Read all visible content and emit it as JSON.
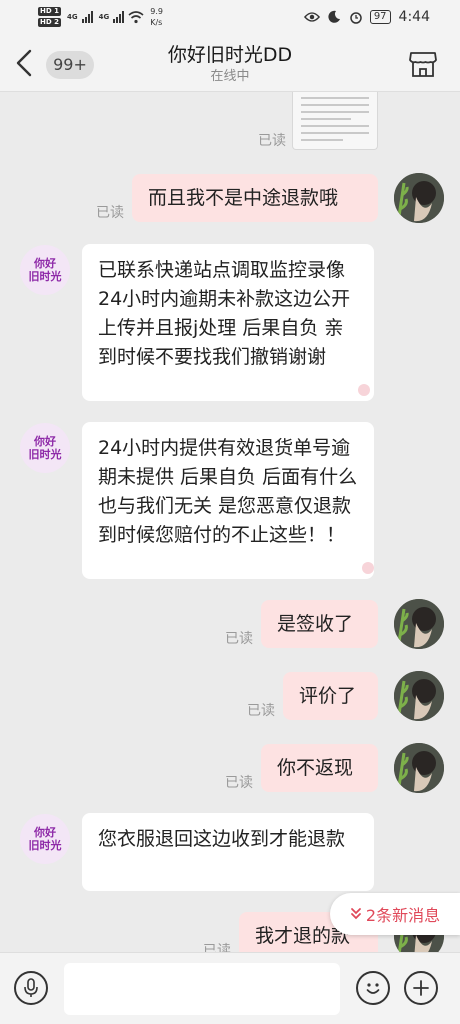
{
  "status_bar": {
    "hd1": "HD 1",
    "hd2": "HD 2",
    "net1": "4G",
    "net2": "4G",
    "speed_value": "9.9",
    "speed_unit": "K/s",
    "battery": "97",
    "time": "4:44"
  },
  "header": {
    "unread_count": "99+",
    "title": "你好旧时光DD",
    "subtitle": "在线中"
  },
  "shop": {
    "avatar_text_line1": "你好",
    "avatar_text_line2": "旧时光"
  },
  "read_label": "已读",
  "messages": [
    {
      "sender": "user",
      "type": "image",
      "status": "已读"
    },
    {
      "sender": "user",
      "text": "而且我不是中途退款哦",
      "status": "已读"
    },
    {
      "sender": "shop",
      "text": "已联系快递站点调取监控录像 24小时内逾期未补款这边公开上传并且报j处理 后果自负 亲到时候不要找我们撤销谢谢"
    },
    {
      "sender": "shop",
      "text": "24小时内提供有效退货单号逾期未提供 后果自负 后面有什么也与我们无关 是您恶意仅退款 到时候您赔付的不止这些！！"
    },
    {
      "sender": "user",
      "text": "是签收了",
      "status": "已读"
    },
    {
      "sender": "user",
      "text": "评价了",
      "status": "已读"
    },
    {
      "sender": "user",
      "text": "你不返现",
      "status": "已读"
    },
    {
      "sender": "shop",
      "text": "您衣服退回这边收到才能退款"
    },
    {
      "sender": "user",
      "text": "我才退的款",
      "status": "已读"
    }
  ],
  "new_messages_banner": "2条新消息",
  "input": {
    "placeholder": ""
  },
  "colors": {
    "outgoing_bubble": "#fde2e2",
    "incoming_bubble": "#ffffff",
    "background": "#ebebeb",
    "banner_text": "#e0495a",
    "shop_avatar_text": "#8e2aa8"
  },
  "icons": [
    "back-arrow-icon",
    "store-icon",
    "voice-icon",
    "emoji-icon",
    "plus-icon",
    "eye-icon",
    "no-disturb-icon",
    "alarm-icon",
    "wifi-icon",
    "double-chevron-down-icon"
  ]
}
